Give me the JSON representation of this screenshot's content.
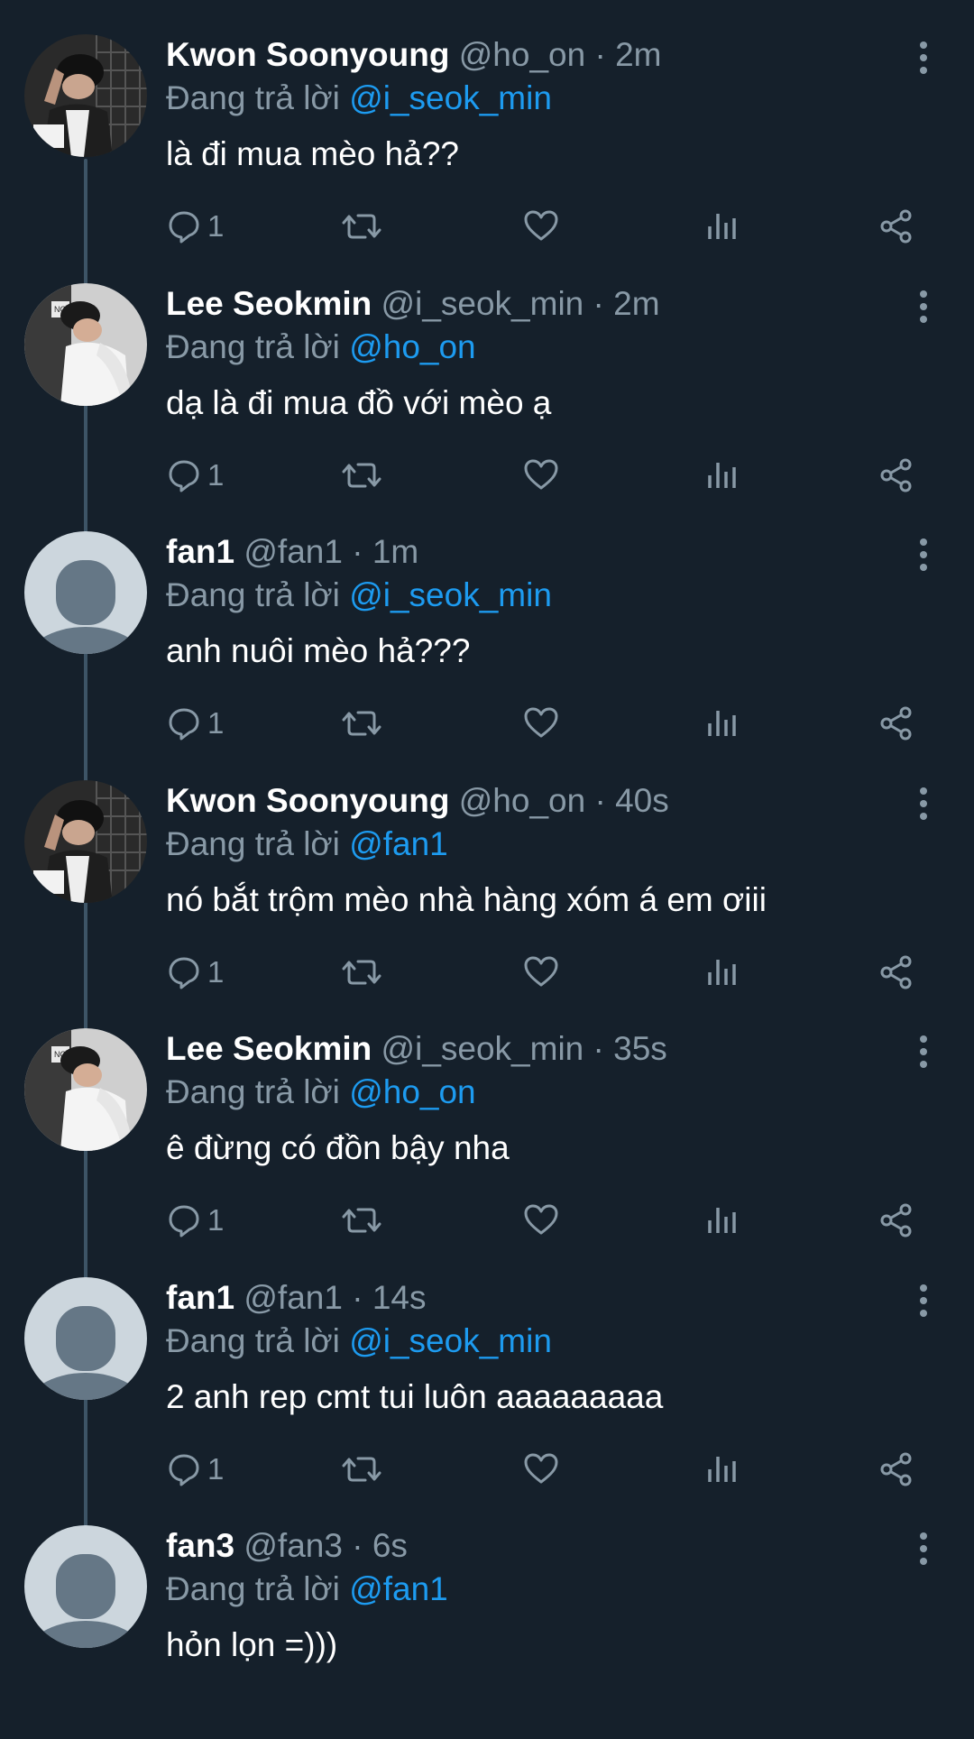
{
  "colors": {
    "background": "#15202b",
    "secondary_text": "#8899a6",
    "link": "#1d9bf0",
    "thread_line": "#3d5466"
  },
  "reply_prefix": "Đang trả lời",
  "tweets": [
    {
      "name": "Kwon Soonyoung",
      "handle": "@ho_on",
      "sep": "·",
      "time": "2m",
      "reply_to": "@i_seok_min",
      "text": "là đi mua mèo hả??",
      "reply_count": "1",
      "avatar": "photo-avatar-soonyoung"
    },
    {
      "name": "Lee Seokmin",
      "handle": "@i_seok_min",
      "sep": "·",
      "time": "2m",
      "reply_to": "@ho_on",
      "text": "dạ là đi mua đồ với mèo ạ",
      "reply_count": "1",
      "avatar": "photo-avatar-seokmin"
    },
    {
      "name": "fan1",
      "handle": "@fan1",
      "sep": "·",
      "time": "1m",
      "reply_to": "@i_seok_min",
      "text": "anh nuôi mèo hả???",
      "reply_count": "1",
      "avatar": "default-avatar"
    },
    {
      "name": "Kwon Soonyoung",
      "handle": "@ho_on",
      "sep": "·",
      "time": "40s",
      "reply_to": "@fan1",
      "text": "nó bắt trộm mèo nhà hàng xóm á em ơiii",
      "reply_count": "1",
      "avatar": "photo-avatar-soonyoung"
    },
    {
      "name": "Lee Seokmin",
      "handle": "@i_seok_min",
      "sep": "·",
      "time": "35s",
      "reply_to": "@ho_on",
      "text": "ê đừng có đồn bậy nha",
      "reply_count": "1",
      "avatar": "photo-avatar-seokmin"
    },
    {
      "name": "fan1",
      "handle": "@fan1",
      "sep": "·",
      "time": "14s",
      "reply_to": "@i_seok_min",
      "text": "2 anh rep cmt tui luôn aaaaaaaaa",
      "reply_count": "1",
      "avatar": "default-avatar"
    },
    {
      "name": "fan3",
      "handle": "@fan3",
      "sep": "·",
      "time": "6s",
      "reply_to": "@fan1",
      "text": "hỏn lọn =)))",
      "reply_count": "",
      "avatar": "default-avatar",
      "no_actions": true
    }
  ]
}
